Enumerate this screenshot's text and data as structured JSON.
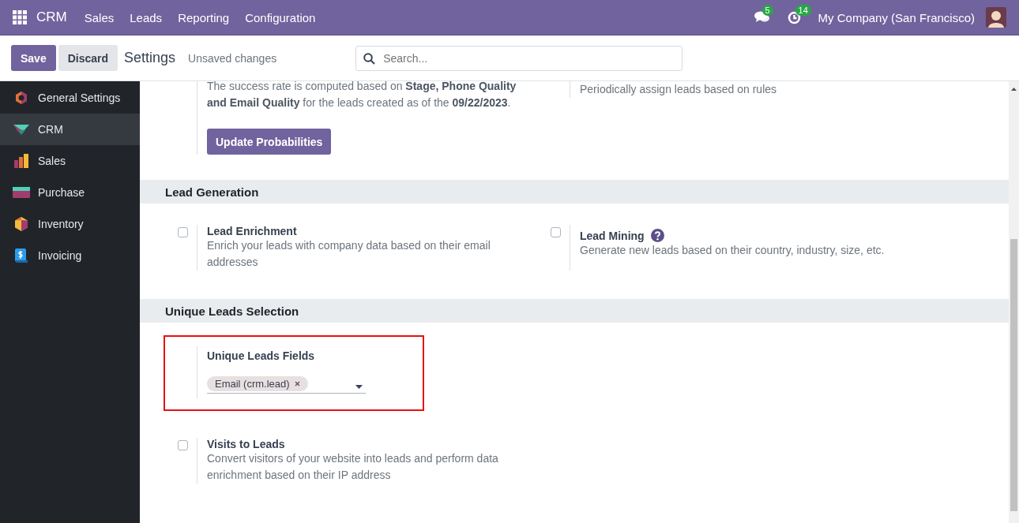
{
  "navbar": {
    "app": "CRM",
    "menu": [
      "Sales",
      "Leads",
      "Reporting",
      "Configuration"
    ],
    "messages_count": "5",
    "activities_count": "14",
    "company": "My Company (San Francisco)"
  },
  "control_panel": {
    "save": "Save",
    "discard": "Discard",
    "breadcrumb": "Settings",
    "status": "Unsaved changes",
    "search": {
      "placeholder": "Search..."
    }
  },
  "sidebar": {
    "items": [
      {
        "label": "General Settings",
        "selected": false
      },
      {
        "label": "CRM",
        "selected": true
      },
      {
        "label": "Sales",
        "selected": false
      },
      {
        "label": "Purchase",
        "selected": false
      },
      {
        "label": "Inventory",
        "selected": false
      },
      {
        "label": "Invoicing",
        "selected": false
      }
    ]
  },
  "partial_section": {
    "left_text": "The success rate is computed based on **Stage, Phone Quality and Email Quality** for the leads created as of the **09/22/2023**.",
    "button": "Update Probabilities",
    "right_text": "Periodically assign leads based on rules"
  },
  "sections": [
    {
      "title": "Lead Generation",
      "settings": [
        {
          "kind": "checkbox",
          "title": "Lead Enrichment",
          "checked": false,
          "description": "Enrich your leads with company data based on their email addresses"
        },
        {
          "kind": "checkbox",
          "title": "Lead Mining",
          "checked": false,
          "help": true,
          "description": "Generate new leads based on their country, industry, size, etc."
        }
      ]
    },
    {
      "title": "Unique Leads Selection",
      "settings": [
        {
          "kind": "tags",
          "title": "Unique Leads Fields",
          "tags": [
            "Email (crm.lead)"
          ],
          "highlighted": true
        },
        {
          "kind": "checkbox",
          "title": "Visits to Leads",
          "checked": false,
          "description": "Convert visitors of your website into leads and perform data enrichment based on their IP address"
        }
      ]
    }
  ]
}
